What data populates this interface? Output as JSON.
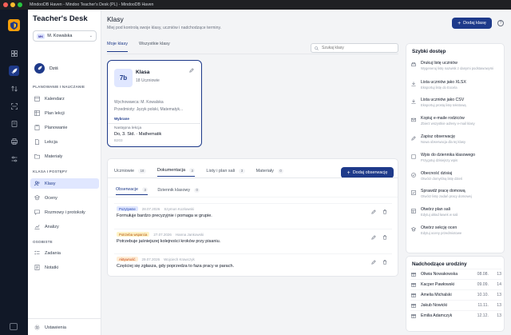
{
  "window": {
    "title": "MindooDB Haven - Mindoo Teacher's Desk (PL) - MindooDB Haven"
  },
  "sidebar": {
    "brand_main": "Teacher's ",
    "brand_accent": "Desk",
    "user_badge": "MK",
    "user_name": "M. Kowalska",
    "today": "Dziś",
    "sections": [
      {
        "title": "PLANOWANIE I NAUCZANIE",
        "items": [
          "Kalendarz",
          "Plan lekcji",
          "Planowanie",
          "Lekcja",
          "Materiały"
        ]
      },
      {
        "title": "KLASA I POSTĘPY",
        "items": [
          "Klasy",
          "Oceny",
          "Rozmowy i protokoły",
          "Analizy"
        ]
      },
      {
        "title": "OSOBISTE",
        "items": [
          "Zadania",
          "Notatki"
        ]
      }
    ],
    "settings": "Ustawienia"
  },
  "header": {
    "title": "Klasy",
    "subtitle": "Miej pod kontrolą swoje klasy, uczniów i nadchodzące terminy.",
    "add_button": "Dodaj klasę",
    "help": "?"
  },
  "tabs": [
    "Moje klasy",
    "Wszystkie klasy"
  ],
  "search": {
    "placeholder": "Szukaj klasy"
  },
  "class_card": {
    "number": "7b",
    "name": "Klasa",
    "count": "18 Uczniowie",
    "teacher": "Wychowawca: M. Kowalska",
    "subjects": "Przedmioty: Język polski, Matematyk...",
    "selected": "Wybrane",
    "next_label": "Następna lekcja",
    "next_day": "Do, 3. Std. · Mathematik",
    "next_room": "B203"
  },
  "panel": {
    "tabs": [
      {
        "label": "Uczniowie",
        "count": "18"
      },
      {
        "label": "Dokumentacja",
        "count": "3"
      },
      {
        "label": "Listy i plan sali",
        "count": "3"
      },
      {
        "label": "Materiały",
        "count": "0"
      }
    ],
    "add_button": "Dodaj obserwację",
    "subtabs": [
      {
        "label": "Obserwacje",
        "count": "3"
      },
      {
        "label": "Dziennik klasowy",
        "count": "0"
      }
    ],
    "observations": [
      {
        "tag": "Pozytywne",
        "date": "28.07.2026",
        "author": "Szymon Kozłowski",
        "text": "Formułuje bardzo precyzyjnie i pomaga w grupie."
      },
      {
        "tag": "Potrzeba wsparcia",
        "date": "27.07.2026",
        "author": "Hanna Jankowski",
        "text": "Potrzebuje jaśniejszej kolejności kroków przy pisaniu."
      },
      {
        "tag": "Aktywność",
        "date": "29.07.2026",
        "author": "Wojciech Krawczyk",
        "text": "Częściej się zgłasza, gdy poprzedza to faza pracy w parach."
      }
    ]
  },
  "quick_access": {
    "title": "Szybki dostęp",
    "items": [
      {
        "title": "Drukuj listę uczniów",
        "desc": "Wygeneruj listę nazwisk z danymi podstawowymi",
        "icon": "printer-icon"
      },
      {
        "title": "Lista uczniów jako XLSX",
        "desc": "Eksportuj listę do Excela",
        "icon": "download-icon"
      },
      {
        "title": "Lista uczniów jako CSV",
        "desc": "Eksportuj prostą listę tekstową",
        "icon": "download-icon"
      },
      {
        "title": "Kopiuj e-maile rodziców",
        "desc": "Zbierz wszystkie adresy e-mail klasy",
        "icon": "mail-icon"
      },
      {
        "title": "Zapisz obserwację",
        "desc": "Nowa obserwacja dla tej klasy",
        "icon": "pen-icon"
      },
      {
        "title": "Wpis do dziennika klasowego",
        "desc": "Przygotuj dzisiejszy wpis",
        "icon": "book-icon"
      },
      {
        "title": "Obecność dzisiaj",
        "desc": "Otwórz domyślną listę dzień",
        "icon": "check-circle-icon"
      },
      {
        "title": "Sprawdź pracę domową",
        "desc": "Otwórz listę zadań pracy domowej",
        "icon": "check-square-icon"
      },
      {
        "title": "Otwórz plan sali",
        "desc": "Edytuj układ ławek w sali",
        "icon": "layout-icon"
      },
      {
        "title": "Otwórz sekcję ocen",
        "desc": "Edytuj oceny przedmiotowe",
        "icon": "grade-icon"
      }
    ]
  },
  "birthdays": {
    "title": "Nadchodzące urodziny",
    "items": [
      {
        "name": "Oliwia Nowakowska",
        "date": "08.08.",
        "age": "13"
      },
      {
        "name": "Kacper Pawłowski",
        "date": "09.09.",
        "age": "14"
      },
      {
        "name": "Amelia Michalski",
        "date": "10.10.",
        "age": "13"
      },
      {
        "name": "Jakub Nowicki",
        "date": "11.11.",
        "age": "13"
      },
      {
        "name": "Emilia Adamczyk",
        "date": "12.12.",
        "age": "13"
      }
    ]
  },
  "colors": {
    "primary": "#1e3a8a",
    "accent_bg": "#e0e7ff",
    "rail": "#111827"
  }
}
